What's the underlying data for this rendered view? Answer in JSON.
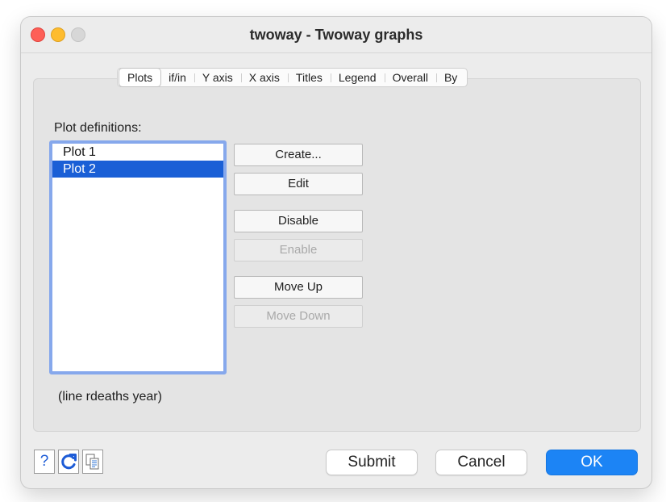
{
  "window": {
    "title": "twoway - Twoway graphs"
  },
  "tabs": [
    {
      "label": "Plots",
      "active": true
    },
    {
      "label": "if/in",
      "active": false
    },
    {
      "label": "Y axis",
      "active": false
    },
    {
      "label": "X axis",
      "active": false
    },
    {
      "label": "Titles",
      "active": false
    },
    {
      "label": "Legend",
      "active": false
    },
    {
      "label": "Overall",
      "active": false
    },
    {
      "label": "By",
      "active": false
    }
  ],
  "plots": {
    "label": "Plot definitions:",
    "items": [
      {
        "label": "Plot 1",
        "selected": false
      },
      {
        "label": "Plot 2",
        "selected": true
      }
    ]
  },
  "buttons": {
    "create": "Create...",
    "edit": "Edit",
    "disable": "Disable",
    "enable": "Enable",
    "move_up": "Move Up",
    "move_down": "Move Down"
  },
  "command_preview": "(line rdeaths year)",
  "footer": {
    "help_label": "?",
    "submit": "Submit",
    "cancel": "Cancel",
    "ok": "OK"
  },
  "icons": {
    "help": "question-mark-icon",
    "reset": "reset-icon",
    "copy": "copy-command-icon"
  },
  "colors": {
    "accent": "#1c84f5",
    "selection": "#1a5fd6",
    "focus_ring": "#86a8ec",
    "close": "#fe5f57",
    "minimize": "#febc2e"
  }
}
